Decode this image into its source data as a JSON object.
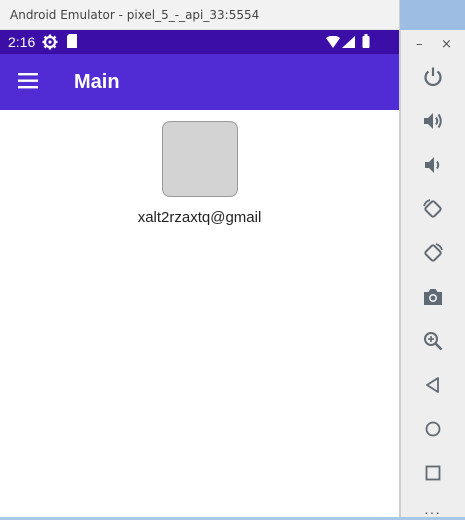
{
  "window": {
    "title": "Android Emulator - pixel_5_-_api_33:5554",
    "minimize_label": "–",
    "close_label": "×"
  },
  "status_bar": {
    "time": "2:16",
    "icons": [
      "settings-icon",
      "sd-card-icon",
      "wifi-icon",
      "cellular-signal-icon",
      "battery-icon"
    ]
  },
  "app_bar": {
    "title": "Main",
    "menu_icon": "hamburger-menu-icon"
  },
  "profile": {
    "avatar_icon": "avatar-placeholder",
    "email": "xalt2rzaxtq@gmail"
  },
  "emulator_controls": [
    {
      "name": "power-icon"
    },
    {
      "name": "volume-up-icon"
    },
    {
      "name": "volume-down-icon"
    },
    {
      "name": "rotate-left-icon"
    },
    {
      "name": "rotate-right-icon"
    },
    {
      "name": "camera-icon"
    },
    {
      "name": "zoom-icon"
    },
    {
      "name": "back-icon"
    },
    {
      "name": "home-icon"
    },
    {
      "name": "overview-icon"
    }
  ],
  "more_label": "···",
  "colors": {
    "status_bar": "#3b0ea8",
    "app_bar": "#512bd4",
    "avatar_bg": "#d3d3d3",
    "icon_gray": "#5f6a75"
  }
}
